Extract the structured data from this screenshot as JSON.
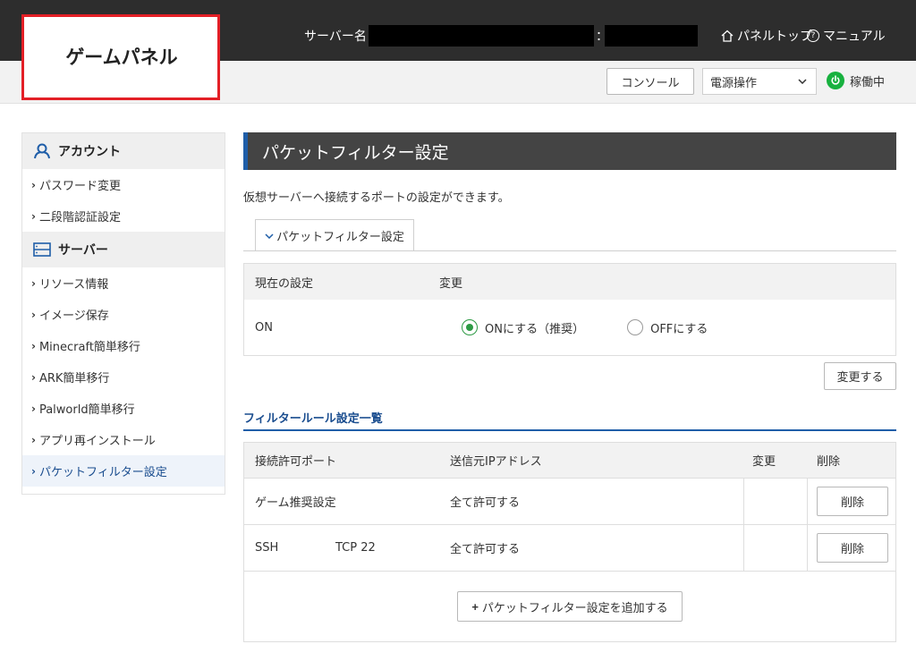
{
  "header": {
    "logo": "ゲームパネル",
    "server_label": "サーバー名：",
    "colon": "：",
    "panel_top": "パネルトップ",
    "manual": "マニュアル",
    "console": "コンソール",
    "power_select": "電源操作",
    "status": "稼働中",
    "colors": {
      "topbar": "#2d2d2d",
      "status": "#18b13f",
      "highlight": "#e31f26"
    }
  },
  "sidebar": {
    "account_heading": "アカウント",
    "server_heading": "サーバー",
    "account_items": [
      {
        "label": "パスワード変更"
      },
      {
        "label": "二段階認証設定"
      }
    ],
    "server_items": [
      {
        "label": "リソース情報"
      },
      {
        "label": "イメージ保存"
      },
      {
        "label": "Minecraft簡単移行"
      },
      {
        "label": "ARK簡単移行"
      },
      {
        "label": "Palworld簡単移行"
      },
      {
        "label": "アプリ再インストール"
      },
      {
        "label": "パケットフィルター設定"
      }
    ]
  },
  "main": {
    "title": "パケットフィルター設定",
    "description": "仮想サーバーへ接続するポートの設定ができます。",
    "tab_label": "パケットフィルター設定",
    "settings_table": {
      "header_current": "現在の設定",
      "header_change": "変更",
      "current_value": "ON",
      "option_on": "ONにする（推奨）",
      "option_off": "OFFにする",
      "selected": "on"
    },
    "change_button": "変更する",
    "rules_section_title": "フィルタールール設定一覧",
    "rules_table": {
      "headers": {
        "port": "接続許可ポート",
        "source_ip": "送信元IPアドレス",
        "change": "変更",
        "delete": "削除"
      },
      "rows": [
        {
          "name": "ゲーム推奨設定",
          "source": "全て許可する",
          "delete": "削除"
        },
        {
          "name": "SSH",
          "port": "TCP 22",
          "source": "全て許可する",
          "delete": "削除"
        }
      ],
      "add_button": "パケットフィルター設定を追加する"
    }
  }
}
